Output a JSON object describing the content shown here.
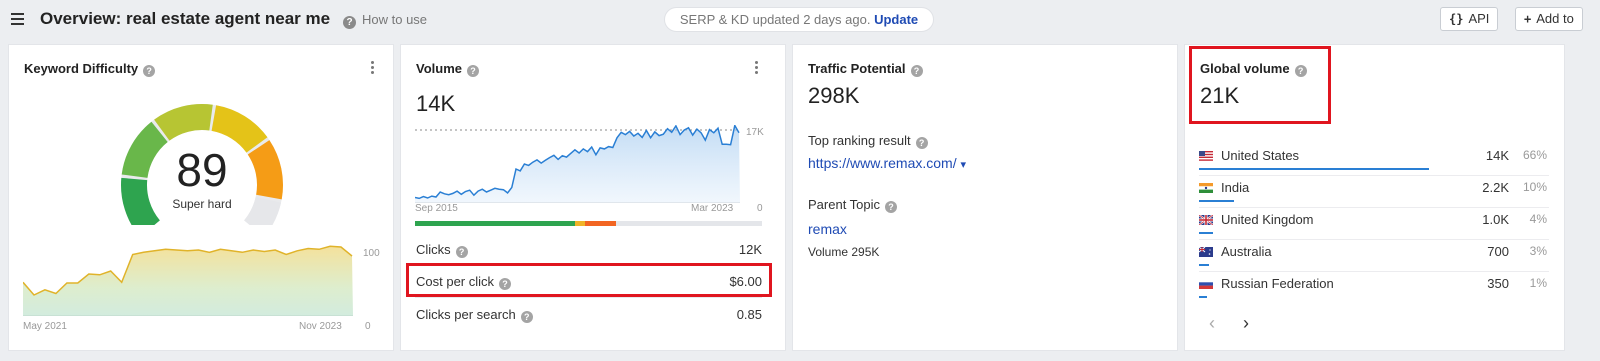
{
  "header": {
    "title": "Overview: real estate agent near me",
    "how_to": "How to use",
    "serp_text": "SERP & KD updated 2 days ago.",
    "serp_link": "Update",
    "api_label": "API",
    "api_icon": "{}",
    "add_label": "Add to",
    "add_icon": "+"
  },
  "kd": {
    "title": "Keyword Difficulty",
    "value": "89",
    "label": "Super hard",
    "score": 89,
    "chart_data": {
      "type": "area",
      "x_start": "May 2021",
      "x_end": "Nov 2023",
      "y_tick_top": "100",
      "y_tick_bottom": "0",
      "ylim": [
        0,
        100
      ],
      "values": [
        45,
        28,
        35,
        30,
        44,
        44,
        56,
        55,
        60,
        45,
        82,
        85,
        87,
        89,
        88,
        87,
        88,
        85,
        89,
        87,
        85,
        88,
        86,
        88,
        82,
        87,
        90,
        89,
        93,
        92,
        80
      ]
    }
  },
  "volume": {
    "title": "Volume",
    "value": "14K",
    "chart_data": {
      "type": "area",
      "x_start": "Sep 2015",
      "x_end": "Mar 2023",
      "y_tick_top": "17K",
      "y_tick_bottom": "0",
      "ylim": [
        0,
        17000
      ],
      "values": [
        1200,
        1000,
        1400,
        1100,
        1500,
        1300,
        2400,
        2000,
        1800,
        2100,
        2600,
        1900,
        2500,
        2800,
        1700,
        2600,
        3000,
        2400,
        2800,
        3200,
        3000,
        2900,
        2200,
        3400,
        7400,
        7000,
        8500,
        8200,
        8900,
        9400,
        8700,
        9300,
        9900,
        10400,
        9500,
        10300,
        10000,
        10800,
        11600,
        10900,
        11800,
        11200,
        12200,
        10500,
        12000,
        11800,
        12300,
        12100,
        14200,
        15400,
        14900,
        15600,
        14600,
        15200,
        14300,
        15800,
        14200,
        15500,
        14700,
        15000,
        16200,
        15400,
        16800,
        14900,
        15900,
        16400,
        14800,
        16100,
        15300,
        13700,
        16000,
        15300,
        16300,
        12800,
        12800,
        12700,
        16900,
        15300
      ]
    },
    "dist_bar": {
      "segments": [
        {
          "value": 0.46,
          "color": "#2ea44f"
        },
        {
          "value": 0.03,
          "color": "#f0b429"
        },
        {
          "value": 0.09,
          "color": "#f26522"
        },
        {
          "value": 0.42,
          "color": "#e4e6ea"
        }
      ]
    },
    "rows": [
      {
        "label": "Clicks",
        "value": "12K"
      },
      {
        "label": "Cost per click",
        "value": "$6.00"
      },
      {
        "label": "Clicks per search",
        "value": "0.85"
      }
    ]
  },
  "traffic": {
    "title": "Traffic Potential",
    "value": "298K",
    "top_ranking_label": "Top ranking result",
    "top_ranking_url": "https://www.remax.com/",
    "top_ranking_caret": "▾",
    "parent_topic_label": "Parent Topic",
    "parent_topic_value": "remax",
    "parent_volume": "Volume 295K"
  },
  "global": {
    "title": "Global volume",
    "value": "21K",
    "countries": [
      {
        "flag": "us-flag",
        "name": "United States",
        "volume": "14K",
        "pct": "66%",
        "share": 0.66
      },
      {
        "flag": "in-flag",
        "name": "India",
        "volume": "2.2K",
        "pct": "10%",
        "share": 0.1
      },
      {
        "flag": "gb-flag",
        "name": "United Kingdom",
        "volume": "1.0K",
        "pct": "4%",
        "share": 0.04
      },
      {
        "flag": "au-flag",
        "name": "Australia",
        "volume": "700",
        "pct": "3%",
        "share": 0.03
      },
      {
        "flag": "ru-flag",
        "name": "Russian Federation",
        "volume": "350",
        "pct": "1%",
        "share": 0.01
      }
    ],
    "prev_icon": "‹",
    "next_icon": "›"
  },
  "colors": {
    "accent_red": "#e0151f",
    "link_blue": "#1f4bb4",
    "volume_line": "#2a7fd4",
    "kd_line": "#e0b32a"
  }
}
